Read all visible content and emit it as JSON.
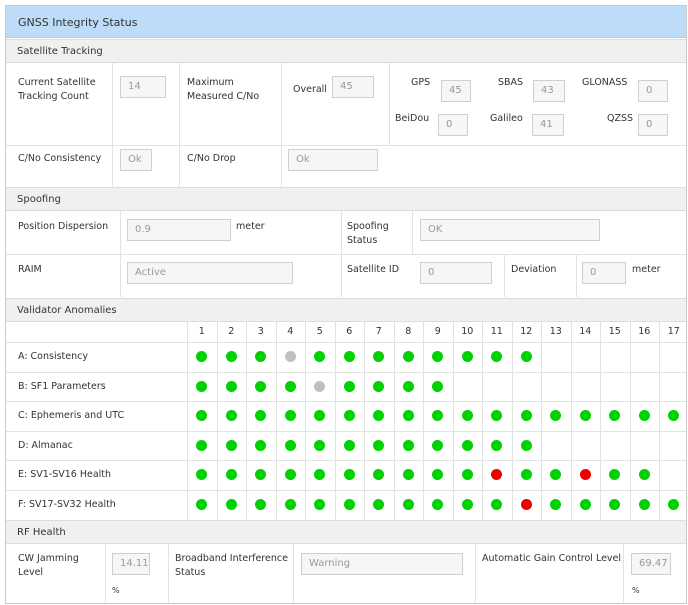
{
  "title": "GNSS Integrity Status",
  "colors": {
    "green": "#00d200",
    "gray": "#c0c0c0",
    "red": "#ee0000",
    "header": "#bcdcf7"
  },
  "sections": {
    "satellite": "Satellite Tracking",
    "spoofing": "Spoofing",
    "anomalies": "Validator Anomalies",
    "rf": "RF Health"
  },
  "satellite": {
    "count_label_1": "Current Satellite",
    "count_label_2": "Tracking Count",
    "count_value": "14",
    "cno_label_1": "Maximum",
    "cno_label_2": "Measured C/No",
    "overall_label": "Overall",
    "overall_value": "45",
    "gps_label": "GPS",
    "gps_value": "45",
    "sbas_label": "SBAS",
    "sbas_value": "43",
    "glonass_label": "GLONASS",
    "glonass_value": "0",
    "beidou_label": "BeiDou",
    "beidou_value": "0",
    "galileo_label": "Galileo",
    "galileo_value": "41",
    "qzss_label": "QZSS",
    "qzss_value": "0",
    "consistency_label": "C/No Consistency",
    "consistency_value": "Ok",
    "drop_label": "C/No Drop",
    "drop_value": "Ok"
  },
  "spoofing": {
    "dispersion_label": "Position Dispersion",
    "dispersion_value": "0.9",
    "dispersion_unit": "meter",
    "status_label_1": "Spoofing",
    "status_label_2": "Status",
    "status_value": "OK",
    "raim_label": "RAIM",
    "raim_value": "Active",
    "satid_label": "Satellite ID",
    "satid_value": "0",
    "deviation_label": "Deviation",
    "deviation_value": "0",
    "deviation_unit": "meter"
  },
  "anomalies": {
    "columns": [
      "1",
      "2",
      "3",
      "4",
      "5",
      "6",
      "7",
      "8",
      "9",
      "10",
      "11",
      "12",
      "13",
      "14",
      "15",
      "16",
      "17"
    ],
    "rows": [
      {
        "label": "A:  Consistency",
        "status": [
          "green",
          "green",
          "green",
          "gray",
          "green",
          "green",
          "green",
          "green",
          "green",
          "green",
          "green",
          "green"
        ]
      },
      {
        "label": "B:  SF1 Parameters",
        "status": [
          "green",
          "green",
          "green",
          "green",
          "gray",
          "green",
          "green",
          "green",
          "green"
        ]
      },
      {
        "label": "C:  Ephemeris and UTC",
        "status": [
          "green",
          "green",
          "green",
          "green",
          "green",
          "green",
          "green",
          "green",
          "green",
          "green",
          "green",
          "green",
          "green",
          "green",
          "green",
          "green",
          "green"
        ]
      },
      {
        "label": "D:  Almanac",
        "status": [
          "green",
          "green",
          "green",
          "green",
          "green",
          "green",
          "green",
          "green",
          "green",
          "green",
          "green",
          "green"
        ]
      },
      {
        "label": "E:  SV1-SV16 Health",
        "status": [
          "green",
          "green",
          "green",
          "green",
          "green",
          "green",
          "green",
          "green",
          "green",
          "green",
          "red",
          "green",
          "green",
          "red",
          "green",
          "green"
        ]
      },
      {
        "label": "F:  SV17-SV32 Health",
        "status": [
          "green",
          "green",
          "green",
          "green",
          "green",
          "green",
          "green",
          "green",
          "green",
          "green",
          "green",
          "red",
          "green",
          "green",
          "green",
          "green",
          "green"
        ]
      }
    ]
  },
  "rf": {
    "cw_label_1": "CW Jamming",
    "cw_label_2": "Level",
    "cw_value": "14.11",
    "cw_unit": "%",
    "bb_label_1": "Broadband Interference",
    "bb_label_2": "Status",
    "bb_value": "Warning",
    "agc_label": "Automatic Gain Control Level",
    "agc_value": "69.47",
    "agc_unit": "%"
  }
}
